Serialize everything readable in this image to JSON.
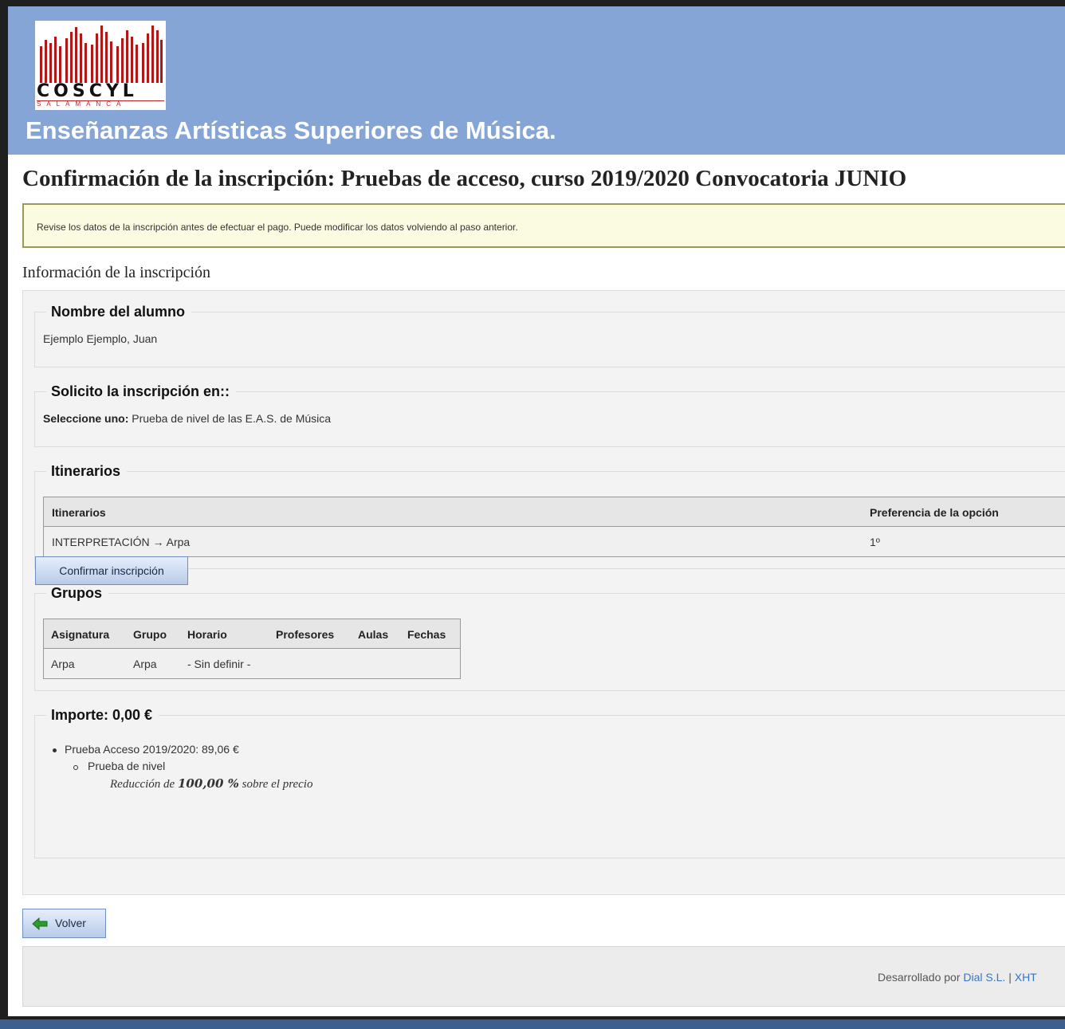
{
  "header": {
    "logo_text": "COSCYL",
    "logo_sub": "SALAMANCA",
    "site_title": "Enseñanzas Artísticas Superiores de Música."
  },
  "page": {
    "title": "Confirmación de la inscripción: Pruebas de acceso, curso 2019/2020 Convocatoria JUNIO",
    "notice": "Revise los datos de la inscripción antes de efectuar el pago. Puede modificar los datos volviendo al paso anterior.",
    "section_title": "Información de la inscripción"
  },
  "student": {
    "legend": "Nombre del alumno",
    "name": "Ejemplo Ejemplo, Juan"
  },
  "enrollment": {
    "legend": "Solicito la inscripción en::",
    "label": "Seleccione uno:",
    "value": "Prueba de nivel de las E.A.S. de Música"
  },
  "itinerarios": {
    "legend": "Itinerarios",
    "columns": [
      "Itinerarios",
      "Preferencia de la opción"
    ],
    "rows": [
      [
        "INTERPRETACIÓN → Arpa",
        "1º"
      ]
    ]
  },
  "grupos": {
    "legend": "Grupos",
    "columns": [
      "Asignatura",
      "Grupo",
      "Horario",
      "Profesores",
      "Aulas",
      "Fechas"
    ],
    "rows": [
      [
        "Arpa",
        "Arpa",
        "- Sin definir -",
        "",
        "",
        ""
      ]
    ]
  },
  "importe": {
    "legend": "Importe: 0,00 €",
    "item": "Prueba Acceso 2019/2020: 89,06 €",
    "subitem": "Prueba de nivel",
    "reduction_prefix": "Reducción de",
    "reduction_value": "100,00 %",
    "reduction_suffix": "sobre el precio"
  },
  "actions": {
    "confirm_label": "Confirmar inscripción",
    "back_label": "Volver"
  },
  "footer": {
    "prefix": "Desarrollado por",
    "company": "Dial S.L.",
    "separator": "|",
    "link2": "XHT"
  },
  "colors": {
    "header_bg": "#84a5d6",
    "notice_bg": "#fbfbe1",
    "link": "#3a74c0"
  }
}
